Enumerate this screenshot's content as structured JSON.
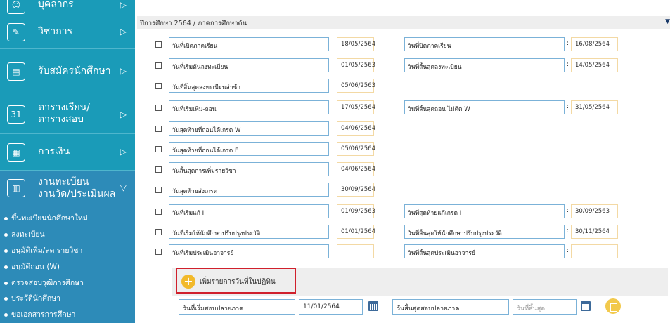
{
  "sidebar": {
    "items": [
      {
        "label": "บุคลากร",
        "label2": ""
      },
      {
        "label": "วิชาการ",
        "label2": ""
      },
      {
        "label": "รับสมัครนักศึกษา",
        "label2": ""
      },
      {
        "label": "ตารางเรียน/",
        "label2": "ตารางสอบ"
      },
      {
        "label": "การเงิน",
        "label2": ""
      },
      {
        "label": "งานทะเบียน",
        "label2": "งานวัด/ประเมินผล"
      }
    ],
    "sub_items": [
      "ขึ้นทะเบียนนักศึกษาใหม่",
      "ลงทะเบียน",
      "อนุมัติเพิ่ม/ลด รายวิชา",
      "อนุมัติถอน (W)",
      "ตรวจสอบวุฒิการศึกษา",
      "ประวัตินักศึกษา",
      "ขอเอกสารการศึกษา"
    ]
  },
  "term": {
    "title": "ปีการศึกษา 2564 / ภาคการศึกษาต้น"
  },
  "rows": [
    {
      "label": "วันที่เปิดภาคเรียน",
      "value": "18/05/2564",
      "label2": "วันที่ปิดภาคเรียน",
      "value2": "16/08/2564"
    },
    {
      "label": "วันที่เริ่มต้นลงทะเบียน",
      "value": "01/05/2563",
      "label2": "วันที่สิ้นสุดลงทะเบียน",
      "value2": "14/05/2564"
    },
    {
      "label": "วันที่สิ้นสุดลงทะเบียนล่าช้า",
      "value": "05/06/2563",
      "label2": "",
      "value2": ""
    },
    {
      "label": "วันที่เริ่มเพิ่ม-ถอน",
      "value": "17/05/2564",
      "label2": "วันที่สิ้นสุดถอน ไม่ติด W",
      "value2": "31/05/2564"
    },
    {
      "label": "วันสุดท้ายที่ถอนได้เกรด W",
      "value": "04/06/2564",
      "label2": "",
      "value2": ""
    },
    {
      "label": "วันสุดท้ายที่ถอนได้เกรด F",
      "value": "05/06/2564",
      "label2": "",
      "value2": ""
    },
    {
      "label": "วันสิ้นสุดการเพิ่มรายวิชา",
      "value": "04/06/2564",
      "label2": "",
      "value2": ""
    },
    {
      "label": "วันสุดท้ายส่งเกรด",
      "value": "30/09/2564",
      "label2": "",
      "value2": ""
    },
    {
      "label": "วันที่เริ่มแก้ I",
      "value": "01/09/2563",
      "label2": "วันที่สุดท้ายแก้เกรด I",
      "value2": "30/09/2563"
    },
    {
      "label": "วันที่เริ่มให้นักศึกษาปรับปรุงประวัติ",
      "value": "01/01/2564",
      "label2": "วันที่สิ้นสุดให้นักศึกษาปรับปรุงประวัติ",
      "value2": "30/11/2564"
    },
    {
      "label": "วันที่เริ่มประเมินอาจารย์",
      "value": "",
      "label2": "วันที่สิ้นสุดประเมินอาจารย์",
      "value2": ""
    }
  ],
  "add_button": {
    "label": "เพิ่มรายการวันที่ในปฏิทิน"
  },
  "new_entry": {
    "start_label": "วันที่เริ่มสอบปลายภาค",
    "start_value": "11/01/2564",
    "end_label": "วันสิ้นสุดสอบปลายภาค",
    "end_placeholder": "วันที่สิ้นสุด"
  }
}
